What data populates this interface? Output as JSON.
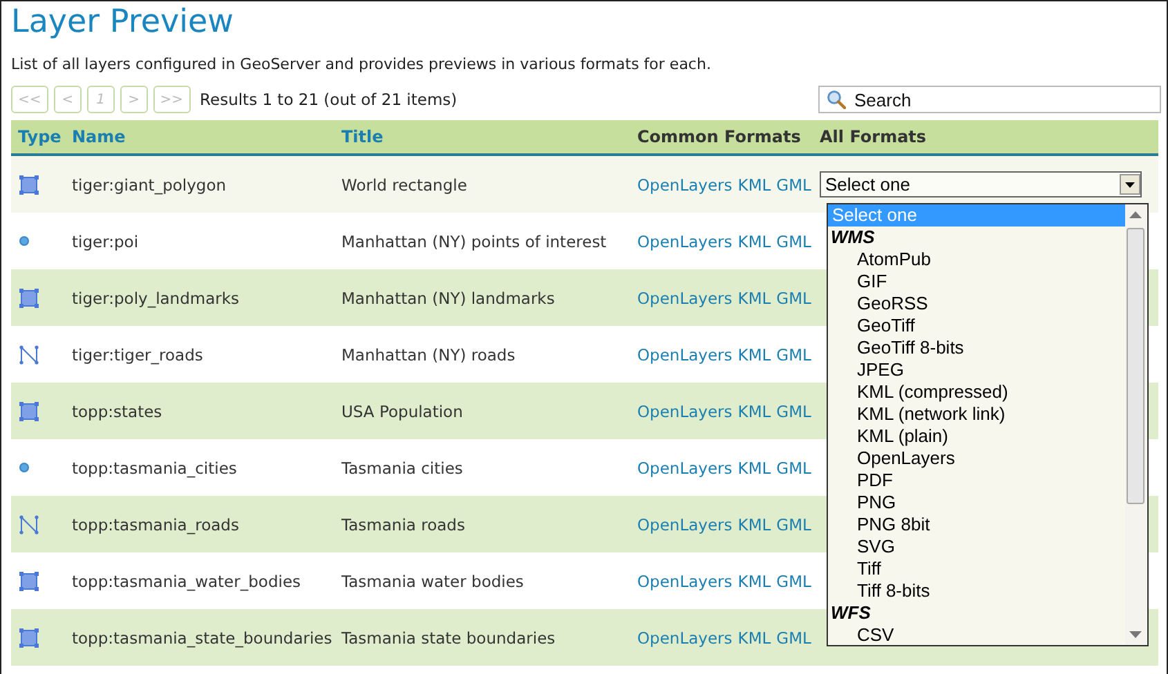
{
  "title": "Layer Preview",
  "description": "List of all layers configured in GeoServer and provides previews in various formats for each.",
  "pager": {
    "buttons": [
      {
        "label": "<<",
        "disabled": true
      },
      {
        "label": "<",
        "disabled": true
      },
      {
        "label": "1",
        "disabled": true
      },
      {
        "label": ">",
        "disabled": true
      },
      {
        "label": ">>",
        "disabled": true
      }
    ],
    "summary": "Results 1 to 21 (out of 21 items)"
  },
  "search": {
    "placeholder": "Search"
  },
  "table": {
    "columns": [
      "Type",
      "Name",
      "Title",
      "Common Formats",
      "All Formats"
    ],
    "rows": [
      {
        "kind": "polygon",
        "name": "tiger:giant_polygon",
        "title": "World rectangle",
        "formats": [
          "OpenLayers",
          "KML",
          "GML"
        ],
        "select": "Select one",
        "highlighted": true
      },
      {
        "kind": "point",
        "name": "tiger:poi",
        "title": "Manhattan (NY) points of interest",
        "formats": [
          "OpenLayers",
          "KML",
          "GML"
        ],
        "highlighted": false
      },
      {
        "kind": "polygon",
        "name": "tiger:poly_landmarks",
        "title": "Manhattan (NY) landmarks",
        "formats": [
          "OpenLayers",
          "KML",
          "GML"
        ],
        "highlighted": false
      },
      {
        "kind": "line",
        "name": "tiger:tiger_roads",
        "title": "Manhattan (NY) roads",
        "formats": [
          "OpenLayers",
          "KML",
          "GML"
        ],
        "highlighted": false
      },
      {
        "kind": "polygon",
        "name": "topp:states",
        "title": "USA Population",
        "formats": [
          "OpenLayers",
          "KML",
          "GML"
        ],
        "highlighted": false
      },
      {
        "kind": "point",
        "name": "topp:tasmania_cities",
        "title": "Tasmania cities",
        "formats": [
          "OpenLayers",
          "KML",
          "GML"
        ],
        "highlighted": false
      },
      {
        "kind": "line",
        "name": "topp:tasmania_roads",
        "title": "Tasmania roads",
        "formats": [
          "OpenLayers",
          "KML",
          "GML"
        ],
        "highlighted": false
      },
      {
        "kind": "polygon",
        "name": "topp:tasmania_water_bodies",
        "title": "Tasmania water bodies",
        "formats": [
          "OpenLayers",
          "KML",
          "GML"
        ],
        "highlighted": false
      },
      {
        "kind": "polygon",
        "name": "topp:tasmania_state_boundaries",
        "title": "Tasmania state boundaries",
        "formats": [
          "OpenLayers",
          "KML",
          "GML"
        ],
        "highlighted": false
      }
    ]
  },
  "dropdown": {
    "options": [
      {
        "kind": "option",
        "label": "Select one",
        "selected": true
      },
      {
        "kind": "group",
        "label": "WMS",
        "selected": false
      },
      {
        "kind": "option",
        "label": "AtomPub",
        "selected": false
      },
      {
        "kind": "option",
        "label": "GIF",
        "selected": false
      },
      {
        "kind": "option",
        "label": "GeoRSS",
        "selected": false
      },
      {
        "kind": "option",
        "label": "GeoTiff",
        "selected": false
      },
      {
        "kind": "option",
        "label": "GeoTiff 8-bits",
        "selected": false
      },
      {
        "kind": "option",
        "label": "JPEG",
        "selected": false
      },
      {
        "kind": "option",
        "label": "KML (compressed)",
        "selected": false
      },
      {
        "kind": "option",
        "label": "KML (network link)",
        "selected": false
      },
      {
        "kind": "option",
        "label": "KML (plain)",
        "selected": false
      },
      {
        "kind": "option",
        "label": "OpenLayers",
        "selected": false
      },
      {
        "kind": "option",
        "label": "PDF",
        "selected": false
      },
      {
        "kind": "option",
        "label": "PNG",
        "selected": false
      },
      {
        "kind": "option",
        "label": "PNG 8bit",
        "selected": false
      },
      {
        "kind": "option",
        "label": "SVG",
        "selected": false
      },
      {
        "kind": "option",
        "label": "Tiff",
        "selected": false
      },
      {
        "kind": "option",
        "label": "Tiff 8-bits",
        "selected": false
      },
      {
        "kind": "group",
        "label": "WFS",
        "selected": false
      },
      {
        "kind": "option",
        "label": "CSV",
        "selected": false
      }
    ]
  }
}
